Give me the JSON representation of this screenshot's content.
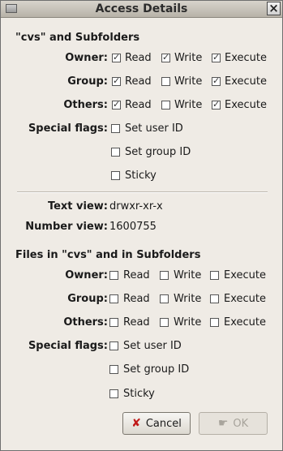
{
  "window": {
    "title": "Access Details"
  },
  "folder_section": {
    "title": "\"cvs\" and Subfolders",
    "rows": [
      {
        "label": "Owner:",
        "read": true,
        "write": true,
        "execute": true
      },
      {
        "label": "Group:",
        "read": true,
        "write": false,
        "execute": true
      },
      {
        "label": "Others:",
        "read": true,
        "write": false,
        "execute": true
      }
    ],
    "special_label": "Special flags:",
    "special": [
      {
        "label": "Set user ID",
        "checked": false
      },
      {
        "label": "Set group ID",
        "checked": false
      },
      {
        "label": "Sticky",
        "checked": false
      }
    ]
  },
  "perm_labels": {
    "read": "Read",
    "write": "Write",
    "execute": "Execute"
  },
  "views": {
    "text_label": "Text view:",
    "text_value": "drwxr-xr-x",
    "number_label": "Number view:",
    "number_value": "1600755"
  },
  "files_section": {
    "title": "Files in \"cvs\" and in Subfolders",
    "rows": [
      {
        "label": "Owner:",
        "read": false,
        "write": false,
        "execute": false
      },
      {
        "label": "Group:",
        "read": false,
        "write": false,
        "execute": false
      },
      {
        "label": "Others:",
        "read": false,
        "write": false,
        "execute": false
      }
    ],
    "special_label": "Special flags:",
    "special": [
      {
        "label": "Set user ID",
        "checked": false
      },
      {
        "label": "Set group ID",
        "checked": false
      },
      {
        "label": "Sticky",
        "checked": false
      }
    ]
  },
  "buttons": {
    "cancel": "Cancel",
    "ok": "OK"
  },
  "icons": {
    "cancel": "cancel-x-icon",
    "ok": "ok-hand-icon",
    "close": "close-icon",
    "window": "folder-icon"
  }
}
